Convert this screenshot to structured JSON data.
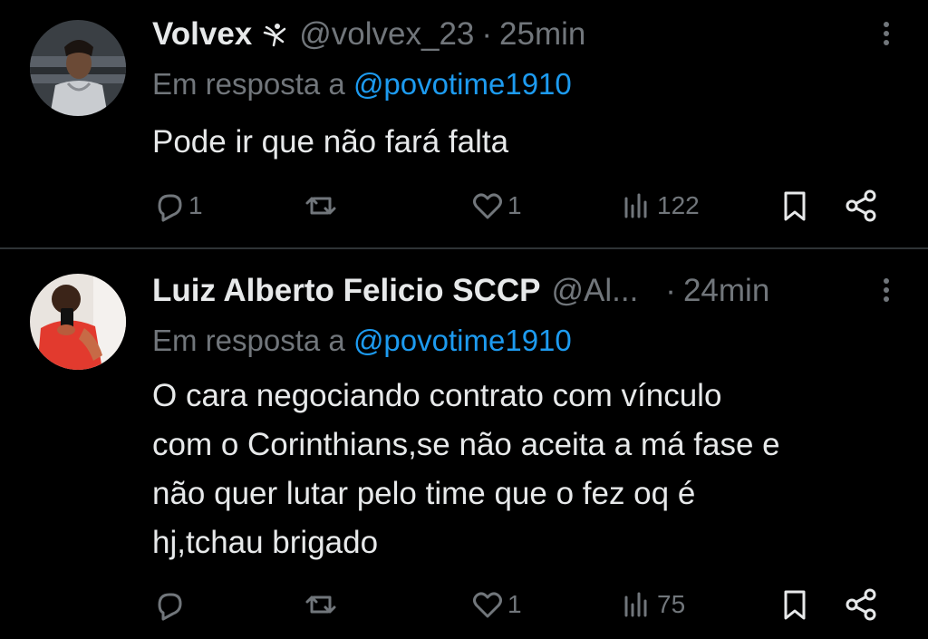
{
  "tweets": [
    {
      "name": "Volvex",
      "handle": "@volvex_23",
      "separator": "·",
      "time": "25min",
      "reply_prefix": "Em resposta a",
      "reply_mention": "@povotime1910",
      "text": "Pode ir que não fará falta",
      "reply_count": "1",
      "retweet_count": "",
      "like_count": "1",
      "view_count": "122"
    },
    {
      "name": "Luiz Alberto Felicio SCCP",
      "handle": "@Al...",
      "separator": "·",
      "time": "24min",
      "reply_prefix": "Em resposta a",
      "reply_mention": "@povotime1910",
      "text": "O cara negociando contrato com vínculo\ncom o Corinthians,se não aceita a má fase e\nnão quer lutar pelo time que o fez oq é\nhj,tchau brigado",
      "reply_count": "",
      "retweet_count": "",
      "like_count": "1",
      "view_count": "75"
    }
  ],
  "colors": {
    "background": "#000000",
    "text": "#e7e9ea",
    "secondary": "#71767b",
    "mention": "#1d9bf0",
    "divider": "#2f3336"
  },
  "icons": [
    "avatar-photo",
    "dancer-badge-icon",
    "more-options-icon",
    "reply-icon",
    "retweet-icon",
    "like-icon",
    "views-icon",
    "bookmark-icon",
    "share-icon"
  ]
}
